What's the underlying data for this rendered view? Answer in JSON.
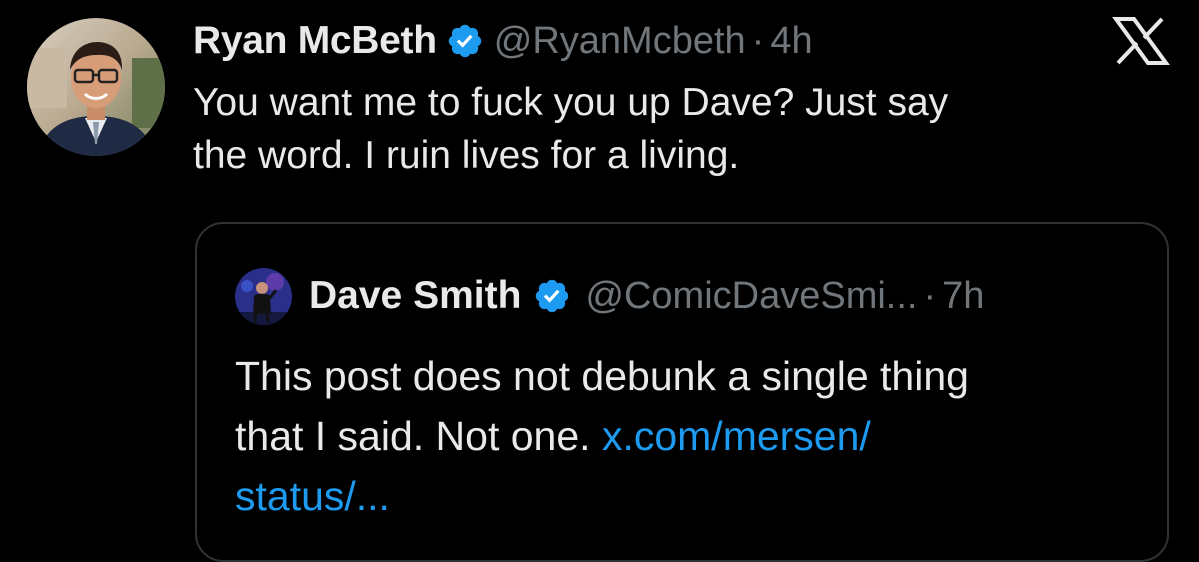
{
  "tweet": {
    "author_name": "Ryan McBeth",
    "author_handle": "@RyanMcbeth",
    "separator": "·",
    "time": "4h",
    "text_line1": "You want me to fuck you up Dave? Just say",
    "text_line2": "the word. I ruin lives for a living.",
    "avatar_icon": "avatar-photo-man-glasses-suit",
    "verified_icon": "verified-badge-icon",
    "platform_icon": "x-logo-icon"
  },
  "quote": {
    "author_name": "Dave Smith",
    "author_handle": "@ComicDaveSmi...",
    "separator": "·",
    "time": "7h",
    "text_line1": "This post does not debunk a single thing",
    "text_line2_prefix": "that I said. Not one.",
    "link_part1": "x.com/mersen/",
    "link_part2": "status/...",
    "avatar_icon": "avatar-photo-comedian-stage",
    "verified_icon": "verified-badge-icon"
  },
  "colors": {
    "background": "#000000",
    "primary_text": "#e7e9ea",
    "secondary_text": "#71767b",
    "link": "#1d9bf0",
    "verified_badge": "#1d9bf0",
    "card_border": "#2f3336"
  }
}
